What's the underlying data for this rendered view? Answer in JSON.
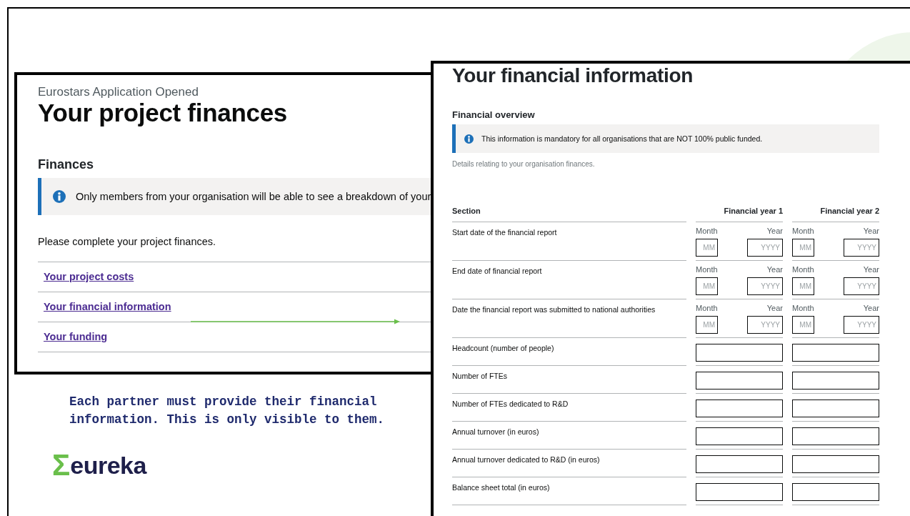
{
  "left_panel": {
    "caption": "Eurostars Application Opened",
    "title": "Your project finances",
    "section_heading": "Finances",
    "notice": "Only members from your organisation will be able to see a breakdown of your",
    "intro": "Please complete your project finances.",
    "links": [
      "Your project costs",
      "Your financial information",
      "Your funding"
    ]
  },
  "right_panel": {
    "title": "Your financial information",
    "section_heading": "Financial overview",
    "notice": "This information is mandatory for all organisations that are NOT 100% public funded.",
    "hint": "Details relating to your organisation finances.",
    "columns": [
      "Section",
      "Financial year 1",
      "Financial year 2"
    ],
    "rows": [
      {
        "kind": "date",
        "label": "Start date of the financial report",
        "fields": [
          {
            "month_label": "Month",
            "year_label": "Year",
            "month_placeholder": "MM",
            "year_placeholder": "YYYY"
          },
          {
            "month_label": "Month",
            "year_label": "Year",
            "month_placeholder": "MM",
            "year_placeholder": "YYYY"
          }
        ]
      },
      {
        "kind": "date",
        "label": "End date of financial report",
        "fields": [
          {
            "month_label": "Month",
            "year_label": "Year",
            "month_placeholder": "MM",
            "year_placeholder": "YYYY"
          },
          {
            "month_label": "Month",
            "year_label": "Year",
            "month_placeholder": "MM",
            "year_placeholder": "YYYY"
          }
        ]
      },
      {
        "kind": "date",
        "label": "Date the financial report was submitted to national authorities",
        "fields": [
          {
            "month_label": "Month",
            "year_label": "Year",
            "month_placeholder": "MM",
            "year_placeholder": "YYYY"
          },
          {
            "month_label": "Month",
            "year_label": "Year",
            "month_placeholder": "MM",
            "year_placeholder": "YYYY"
          }
        ]
      },
      {
        "kind": "number",
        "label": "Headcount (number of people)"
      },
      {
        "kind": "number",
        "label": "Number of FTEs"
      },
      {
        "kind": "number",
        "label": "Number of FTEs dedicated to R&D"
      },
      {
        "kind": "number",
        "label": "Annual turnover (in euros)"
      },
      {
        "kind": "number",
        "label": "Annual turnover dedicated to R&D (in euros)"
      },
      {
        "kind": "number",
        "label": "Balance sheet total (in euros)"
      }
    ]
  },
  "caption": "Each partner must provide their financial information. This is only visible to them.",
  "logo": {
    "symbol": "Σ",
    "text": "eureka"
  }
}
